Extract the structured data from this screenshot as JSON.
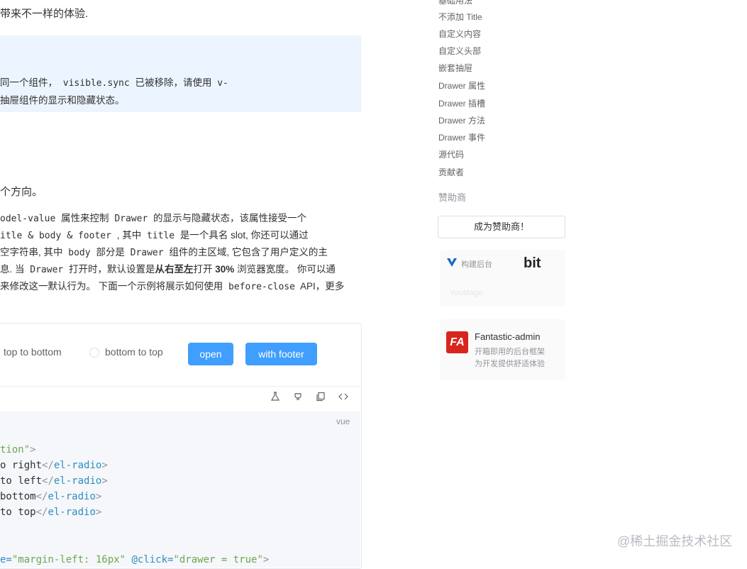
{
  "content": {
    "intro": "带来不一样的体验.",
    "tip": {
      "line1_a": "同一个组件，",
      "line1_code": "visible.sync",
      "line1_b": "已被移除，请使用",
      "line1_c": "v-",
      "line2": "抽屉组件的显示和隐藏状态。"
    },
    "section_line": "个方向。",
    "para": {
      "l1_code1": "odel-value",
      "l1_a": "属性来控制",
      "l1_code2": "Drawer",
      "l1_b": "的显示与隐藏状态，该属性接受一个",
      "l2_code1": "itle",
      "l2_amp1": "&",
      "l2_code2": "body",
      "l2_amp2": "&",
      "l2_code3": "footer",
      "l2_a": ", 其中",
      "l2_code4": "title",
      "l2_b": "是一个具名 slot, 你还可以通过",
      "l3_a": "空字符串, 其中",
      "l3_code1": "body",
      "l3_b": "部分是",
      "l3_code2": "Drawer",
      "l3_c": "组件的主区域, 它包含了用户定义的主",
      "l4_a": "息. 当",
      "l4_code1": "Drawer",
      "l4_b": "打开时，默认设置是",
      "l4_bold1": "从右至左",
      "l4_c": "打开",
      "l4_bold2": "30%",
      "l4_d": "浏览器宽度。 你可以通",
      "l5_a": "来修改这一默认行为。 下面一个示例将展示如何使用",
      "l5_code1": "before-close",
      "l5_b": "API，更多"
    },
    "demo": {
      "radio_ttb": "top to bottom",
      "radio_btt": "bottom to top",
      "btn_open": "open",
      "btn_footer": "with footer",
      "lang": "vue",
      "code": {
        "l1_a": "tion",
        "l1_b": "\">",
        "l2_txt": "o right",
        "l2_close": "</",
        "l2_tag": "el-radio",
        "l2_end": ">",
        "l3_txt": "to left",
        "l4_txt": " bottom",
        "l5_txt": " to top",
        "l6_a": "e=",
        "l6_str1": "\"margin-left: 16px\"",
        "l6_b": " @click=",
        "l6_str2": "\"drawer = true\"",
        "l6_c": ">"
      }
    }
  },
  "sidebar": {
    "toc": [
      "基础用法",
      "不添加 Title",
      "自定义内容",
      "自定义头部",
      "嵌套抽屉",
      "Drawer 属性",
      "Drawer 插槽",
      "Drawer 方法",
      "Drawer 事件",
      "源代码",
      "贡献者"
    ],
    "sponsor_heading": "赞助商",
    "sponsor_button": "成为赞助商！",
    "sponsor1": {
      "logo_text": "构建后台",
      "brand2": "bit",
      "brand3": "YouMage"
    },
    "sponsor2": {
      "logo": "FA",
      "title": "Fantastic-admin",
      "desc1": "开箱即用的后台框架",
      "desc2": "为开发提供舒适体验"
    }
  },
  "watermark": "@稀土掘金技术社区",
  "colors": {
    "primary": "#409eff",
    "tip_bg": "#ecf5ff",
    "code_bg": "#f5f7fa",
    "fa_red": "#d7261e"
  },
  "icons": [
    "flask-icon",
    "github-icon",
    "copy-icon",
    "code-icon",
    "vuetify-v-icon"
  ]
}
